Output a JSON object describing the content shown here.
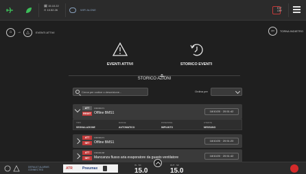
{
  "topbar": {
    "time_line1": "🗓 15.10.22",
    "time_line2": "⊙ 10.52.26",
    "wifi_label": "WIFI ALONE",
    "badge_line1": "EXT",
    "badge_line2": "OFF"
  },
  "breadcrumb": {
    "label": "EVENTI ATTIVI"
  },
  "back": {
    "label": "TORNA INDIETRO"
  },
  "tabs": [
    {
      "label": "EVENTI ATTIVI"
    },
    {
      "label": "STORICO EVENTI"
    }
  ],
  "section_title": "STORICO AZIONI",
  "search": {
    "placeholder": "Cerca per codice o descrizione..."
  },
  "sort": {
    "label": "Ordina per"
  },
  "events": [
    {
      "status": "ATT",
      "type": "RESET",
      "id": "F00000471",
      "title": "Offline BMS1",
      "timestamp": "18/10/20 · 20:51:42",
      "details": {
        "headers": [
          "TIPO",
          "RANGE",
          "POSIZIONE",
          "UTENTE"
        ],
        "values": [
          "SEGNALAZIONE",
          "AUTOMATICO",
          "IMPIANTO",
          "NESSUNO"
        ]
      }
    },
    {
      "status": "ATT",
      "type": "SET",
      "id": "F00000471",
      "title": "Offline BMS1",
      "timestamp": "18/10/20 · 20:51:20"
    },
    {
      "status": "ATT",
      "type": "SET",
      "id": "F00000168",
      "title": "Mancanza flusso aria evaporatore da guasto ventilatore",
      "timestamp": "18/10/20 · 20:51:42"
    }
  ],
  "bottombar": {
    "text_line1": "DEFAULT ALARMS",
    "text_line2": "CONNECTED",
    "logo_a": "ATR",
    "logo_b": "Pneumax",
    "temp_left": "15.0",
    "temp_right": "15.0",
    "temp_left_small": "IN · SC",
    "temp_right_small": "OUT · SC"
  },
  "colors": {
    "accent_red": "#c43a3a",
    "accent_blue": "#8aa3c0",
    "background": "#1f1f1f"
  }
}
